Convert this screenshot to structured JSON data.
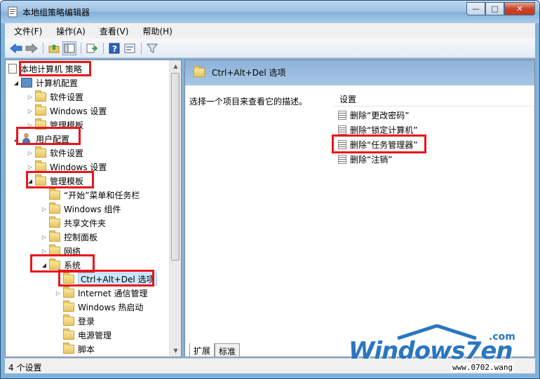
{
  "window": {
    "title": "本地组策略编辑器"
  },
  "window_buttons": {
    "minimize": "—",
    "maximize": "□",
    "close": "✕"
  },
  "menu": [
    "文件(F)",
    "操作(A)",
    "查看(V)",
    "帮助(H)"
  ],
  "toolbar": {
    "icons": [
      "back-arrow-icon",
      "forward-arrow-icon",
      "up-folder-icon",
      "show-tree-icon",
      "export-list-icon",
      "help-icon",
      "properties-icon",
      "filter-icon"
    ]
  },
  "tree": {
    "root": "本地计算机 策略",
    "computer_config": "计算机配置",
    "software_settings_1": "软件设置",
    "windows_settings_1": "Windows 设置",
    "admin_templates_1": "管理模板",
    "user_config": "用户配置",
    "software_settings_2": "软件设置",
    "windows_settings_2": "Windows 设置",
    "admin_templates_2": "管理模板",
    "start_menu": "“开始”菜单和任务栏",
    "windows_components": "Windows 组件",
    "shared_folders": "共享文件夹",
    "control_panel": "控制面板",
    "network": "网络",
    "system": "系统",
    "ctrl_alt_del": "Ctrl+Alt+Del 选项",
    "internet_comm": "Internet 通信管理",
    "windows_hotstart": "Windows 热启动",
    "logon": "登录",
    "power_mgmt": "电源管理",
    "scripts": "脚本"
  },
  "right_pane": {
    "header": "Ctrl+Alt+Del 选项",
    "description": "选择一个项目来查看它的描述。",
    "column": "设置",
    "items": [
      "删除“更改密码”",
      "删除“锁定计算机”",
      "删除“任务管理器”",
      "删除“注销”"
    ],
    "tabs": [
      "扩展",
      "标准"
    ]
  },
  "status": {
    "text": "4 个设置"
  },
  "watermark": {
    "logo": "Windows7en",
    "com": ".com",
    "url": "www.0702.wang"
  },
  "colors": {
    "highlight": "#e8151c",
    "title_bar": "#9ec3e4",
    "header_bar": "#a8c6e5"
  }
}
